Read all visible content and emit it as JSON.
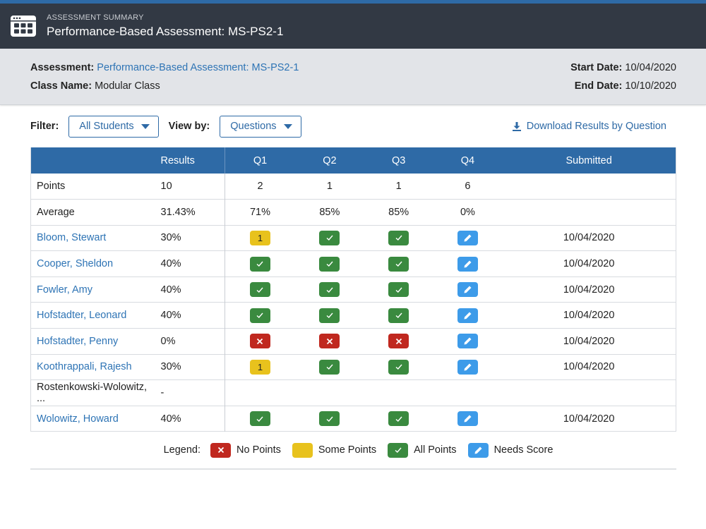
{
  "header": {
    "subtitle": "ASSESSMENT SUMMARY",
    "title": "Performance-Based Assessment: MS-PS2-1",
    "icon": "calendar-grid-icon"
  },
  "info": {
    "assessment_label": "Assessment:",
    "assessment_value": "Performance-Based Assessment: MS-PS2-1",
    "class_label": "Class Name:",
    "class_value": "Modular Class",
    "start_label": "Start Date:",
    "start_value": "10/04/2020",
    "end_label": "End Date:",
    "end_value": "10/10/2020"
  },
  "toolbar": {
    "filter_label": "Filter:",
    "filter_value": "All Students",
    "viewby_label": "View by:",
    "viewby_value": "Questions",
    "download_label": "Download Results by Question"
  },
  "table": {
    "headers": [
      "",
      "Results",
      "Q1",
      "Q2",
      "Q3",
      "Q4",
      "Submitted"
    ],
    "points": {
      "label": "Points",
      "results": "10",
      "q": [
        "2",
        "1",
        "1",
        "6"
      ],
      "submitted": ""
    },
    "average": {
      "label": "Average",
      "results": "31.43%",
      "q": [
        "71%",
        "85%",
        "85%",
        "0%"
      ],
      "submitted": ""
    },
    "students": [
      {
        "name": "Bloom, Stewart",
        "link": true,
        "results": "30%",
        "q": [
          {
            "status": "some",
            "value": "1"
          },
          {
            "status": "all"
          },
          {
            "status": "all"
          },
          {
            "status": "needs"
          }
        ],
        "submitted": "10/04/2020"
      },
      {
        "name": "Cooper, Sheldon",
        "link": true,
        "results": "40%",
        "q": [
          {
            "status": "all"
          },
          {
            "status": "all"
          },
          {
            "status": "all"
          },
          {
            "status": "needs"
          }
        ],
        "submitted": "10/04/2020"
      },
      {
        "name": "Fowler, Amy",
        "link": true,
        "results": "40%",
        "q": [
          {
            "status": "all"
          },
          {
            "status": "all"
          },
          {
            "status": "all"
          },
          {
            "status": "needs"
          }
        ],
        "submitted": "10/04/2020"
      },
      {
        "name": "Hofstadter, Leonard",
        "link": true,
        "results": "40%",
        "q": [
          {
            "status": "all"
          },
          {
            "status": "all"
          },
          {
            "status": "all"
          },
          {
            "status": "needs"
          }
        ],
        "submitted": "10/04/2020"
      },
      {
        "name": "Hofstadter, Penny",
        "link": true,
        "results": "0%",
        "q": [
          {
            "status": "none"
          },
          {
            "status": "none"
          },
          {
            "status": "none"
          },
          {
            "status": "needs"
          }
        ],
        "submitted": "10/04/2020"
      },
      {
        "name": "Koothrappali, Rajesh",
        "link": true,
        "results": "30%",
        "q": [
          {
            "status": "some",
            "value": "1"
          },
          {
            "status": "all"
          },
          {
            "status": "all"
          },
          {
            "status": "needs"
          }
        ],
        "submitted": "10/04/2020"
      },
      {
        "name": "Rostenkowski-Wolowitz, ...",
        "link": false,
        "results": "-",
        "q": [
          null,
          null,
          null,
          null
        ],
        "submitted": ""
      },
      {
        "name": "Wolowitz, Howard",
        "link": true,
        "results": "40%",
        "q": [
          {
            "status": "all"
          },
          {
            "status": "all"
          },
          {
            "status": "all"
          },
          {
            "status": "needs"
          }
        ],
        "submitted": "10/04/2020"
      }
    ]
  },
  "legend": {
    "label": "Legend:",
    "items": [
      {
        "status": "none",
        "label": "No Points"
      },
      {
        "status": "some",
        "label": "Some Points"
      },
      {
        "status": "all",
        "label": "All Points"
      },
      {
        "status": "needs",
        "label": "Needs Score"
      }
    ]
  },
  "colors": {
    "brand_blue": "#2e6aa6",
    "header_bg": "#323944",
    "no_points": "#c0281f",
    "some_points": "#e8c21d",
    "all_points": "#3a8a3f",
    "needs_score": "#3d9be9",
    "link": "#2e74b5"
  }
}
